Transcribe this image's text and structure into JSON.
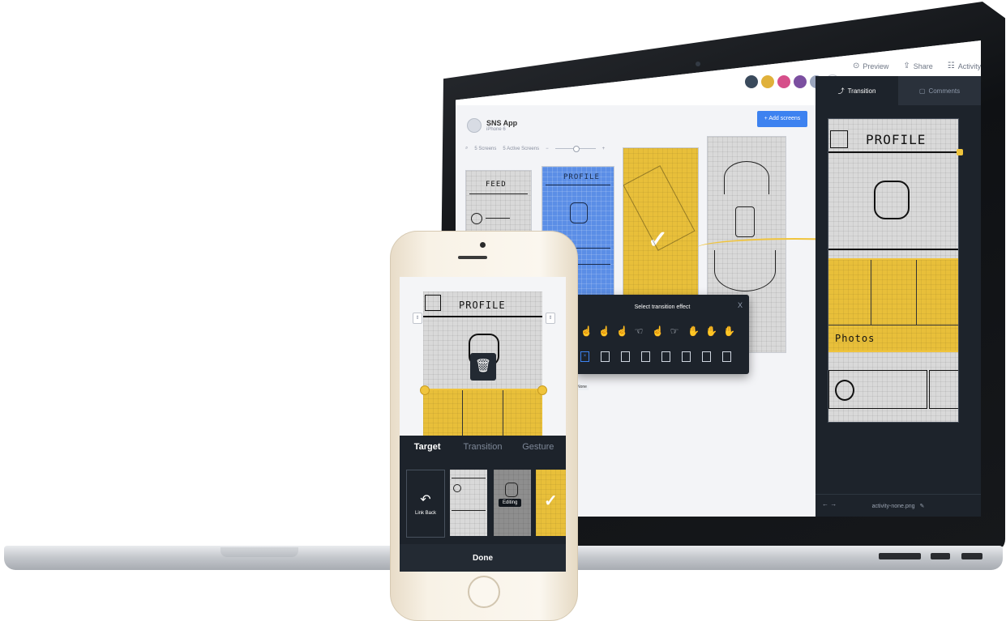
{
  "app": {
    "project_name": "SNS App",
    "project_sub": "iPhone 6",
    "add_screens_label": "+ Add screens",
    "screens_count": "5 Screens",
    "active_screens": "5 Active Screens"
  },
  "top_actions": {
    "preview": "Preview",
    "share": "Share",
    "activity": "Activity"
  },
  "collaborators_add": "+",
  "right_panel": {
    "tab_transition": "Transition",
    "tab_comments": "Comments",
    "file_name": "activity-none.png",
    "nav_arrows": "← →"
  },
  "effects": {
    "title": "Select transition effect",
    "close": "X",
    "tooltip": "None"
  },
  "screens": {
    "feed_title": "FEED",
    "profile_title": "PROFILE",
    "photos_label": "Photos"
  },
  "phone": {
    "tab_target": "Target",
    "tab_transition": "Transition",
    "tab_gesture": "Gesture",
    "link_back": "Link Back",
    "editing": "Editing",
    "done": "Done",
    "profile_title": "PROFILE"
  },
  "colors": {
    "accent_blue": "#3d82f0",
    "hotspot_yellow": "#f0c43c",
    "dark_panel": "#1d232b"
  },
  "icons": {
    "preview": "preview-icon",
    "share": "share-icon",
    "activity": "activity-icon",
    "trash": "trash-icon",
    "link_back": "undo-arrow-icon",
    "check": "checkmark-icon"
  }
}
